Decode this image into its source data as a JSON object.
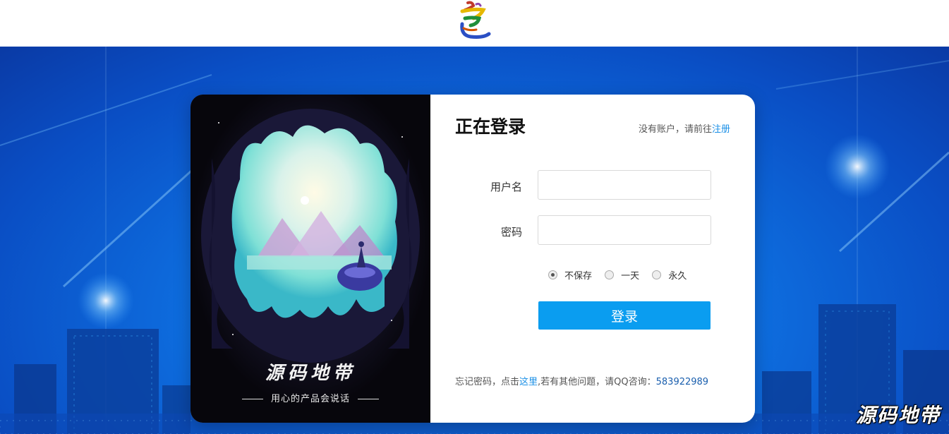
{
  "header": {
    "logo_icon": "calligraphy-logo-icon"
  },
  "login": {
    "title": "正在登录",
    "signup_prompt": "没有账户，请前往",
    "signup_link": "注册",
    "username_label": "用户名",
    "username_value": "",
    "password_label": "密码",
    "password_value": "",
    "remember_options": [
      {
        "label": "不保存",
        "selected": true
      },
      {
        "label": "一天",
        "selected": false
      },
      {
        "label": "永久",
        "selected": false
      }
    ],
    "submit_label": "登录",
    "footer_text_1": "忘记密码，点击",
    "footer_link": "这里",
    "footer_text_2": ",若有其他问题，请QQ咨询：",
    "footer_qq": "583922989"
  },
  "brand": {
    "title": "源码地带",
    "subtitle": "用心的产品会说话"
  },
  "watermark": "源码地带",
  "colors": {
    "primary": "#0a9df0",
    "link": "#1a8fe6",
    "background_blue": "#0e6fe0"
  }
}
